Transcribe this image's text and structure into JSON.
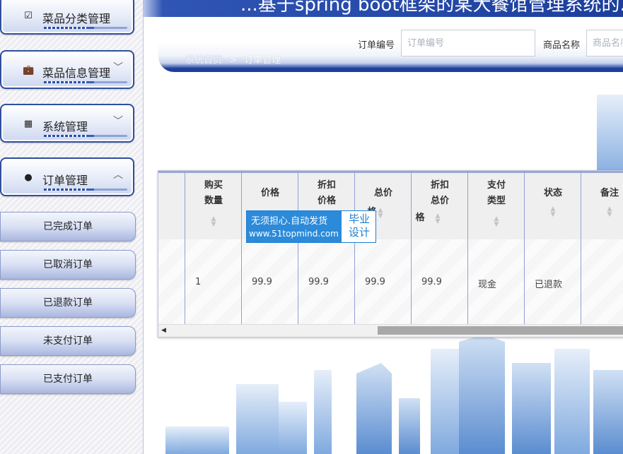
{
  "app": {
    "title": "...基于spring boot框架的某大餐馆管理系统的..."
  },
  "sidebar": {
    "groups": [
      {
        "label": "菜品分类管理",
        "icon": "checkbox-icon",
        "expanded": false
      },
      {
        "label": "菜品信息管理",
        "icon": "briefcase-icon",
        "expanded": false
      },
      {
        "label": "系统管理",
        "icon": "grid-icon",
        "expanded": false
      },
      {
        "label": "订单管理",
        "icon": "lightbulb-icon",
        "expanded": true
      }
    ],
    "order_items": [
      "已完成订单",
      "已取消订单",
      "已退款订单",
      "未支付订单",
      "已支付订单"
    ]
  },
  "breadcrumb": {
    "home": "系统首页",
    "separator": ">",
    "current": "订单管理"
  },
  "search": {
    "order_no_label": "订单编号",
    "order_no_placeholder": "订单编号",
    "product_name_label": "商品名称",
    "product_name_placeholder": "商品名称"
  },
  "table": {
    "columns": [
      {
        "line1": "购买",
        "line2": "数量",
        "line3": ""
      },
      {
        "line1": "价格",
        "line2": "",
        "line3": ""
      },
      {
        "line1": "折扣",
        "line2": "价格",
        "line3": ""
      },
      {
        "line1": "总价",
        "line2": "格",
        "line3": ""
      },
      {
        "line1": "折扣",
        "line2": "总价",
        "line3": "格"
      },
      {
        "line1": "支付",
        "line2": "类型",
        "line3": ""
      },
      {
        "line1": "状态",
        "line2": "",
        "line3": ""
      },
      {
        "line1": "备注",
        "line2": "",
        "line3": ""
      }
    ],
    "rows": [
      {
        "quantity": "1",
        "price": "99.9",
        "discount_price": "99.9",
        "total_price": "99.9",
        "discount_total": "99.9",
        "pay_type": "现金",
        "status": "已退款",
        "note": ""
      }
    ]
  },
  "watermark": {
    "line1": "无须担心.自动发货",
    "line2": "www.51topmind.com",
    "badge": "毕业设计"
  },
  "colors": {
    "accent": "#1c3f9c",
    "sidebar_border": "#2f4f9f",
    "column_divider": "#8fa2d6"
  }
}
